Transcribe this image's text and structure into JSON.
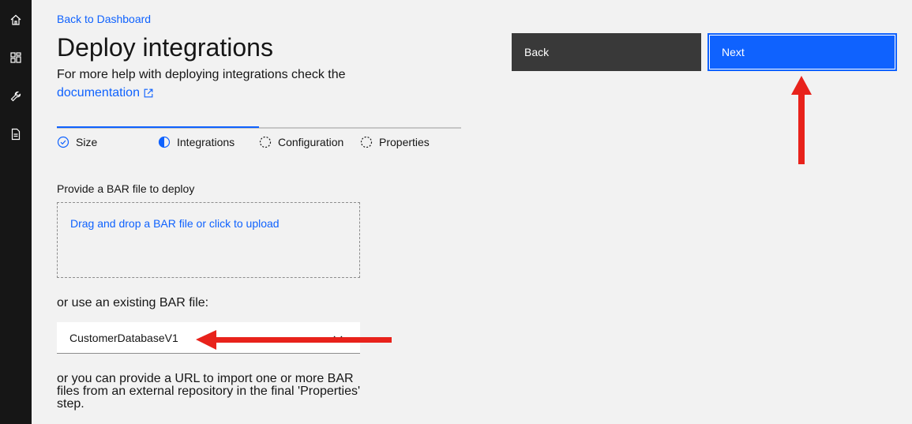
{
  "sidebar": {
    "items": [
      {
        "icon": "home-icon"
      },
      {
        "icon": "dashboard-icon"
      },
      {
        "icon": "wrench-icon"
      },
      {
        "icon": "document-icon"
      }
    ]
  },
  "header": {
    "back_link": "Back to Dashboard",
    "title": "Deploy integrations",
    "help_text": "For more help with deploying integrations check the",
    "doc_link": "documentation"
  },
  "progress": {
    "steps": [
      {
        "label": "Size",
        "state": "complete"
      },
      {
        "label": "Integrations",
        "state": "current"
      },
      {
        "label": "Configuration",
        "state": "incomplete"
      },
      {
        "label": "Properties",
        "state": "incomplete"
      }
    ]
  },
  "upload": {
    "label": "Provide a BAR file to deploy",
    "dropzone_text": "Drag and drop a BAR file or click to upload"
  },
  "existing": {
    "label": "or use an existing BAR file:",
    "selected_value": "CustomerDatabaseV1"
  },
  "url_hint": "or you can provide a URL to import one or more BAR files from an external repository in the final 'Properties' step.",
  "actions": {
    "back_label": "Back",
    "next_label": "Next"
  },
  "colors": {
    "accent": "#0f62fe",
    "annotation_arrow": "#e8221b",
    "sidebar_bg": "#161616"
  }
}
